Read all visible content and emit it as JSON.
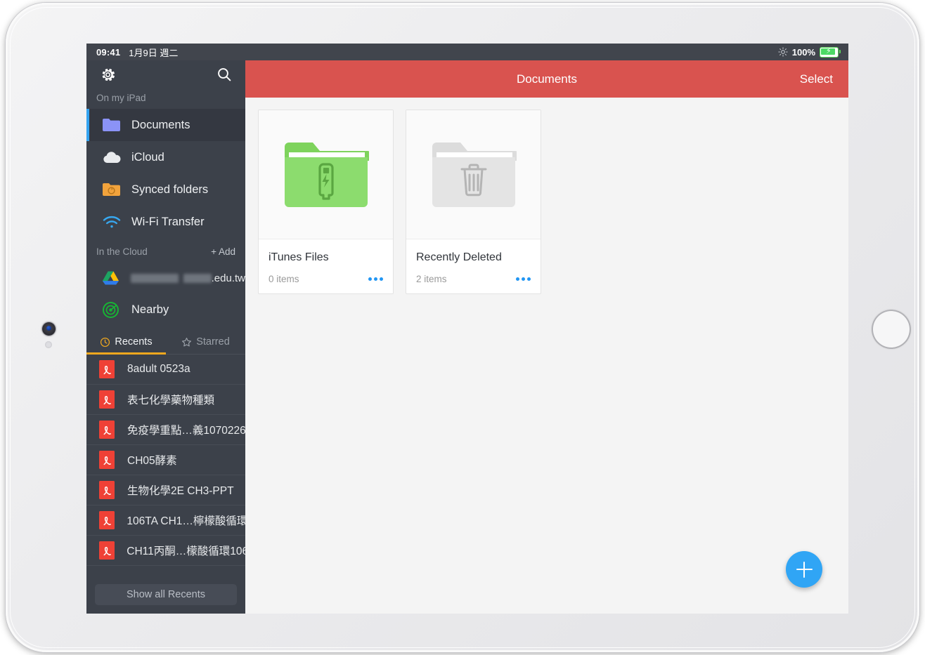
{
  "status_bar": {
    "time": "09:41",
    "date": "1月9日 週二",
    "brightness_icon": "sun-icon",
    "battery_percent": "100%",
    "battery_icon": "battery-charging-icon"
  },
  "sidebar": {
    "settings_icon": "gear-icon",
    "search_icon": "search-icon",
    "on_my_ipad_label": "On my iPad",
    "local_items": [
      {
        "label": "Documents",
        "icon": "folder-icon",
        "selected": true
      },
      {
        "label": "iCloud",
        "icon": "cloud-icon",
        "selected": false
      },
      {
        "label": "Synced folders",
        "icon": "synced-folder-icon",
        "selected": false
      },
      {
        "label": "Wi-Fi Transfer",
        "icon": "wifi-icon",
        "selected": false
      }
    ],
    "in_the_cloud_label": "In the Cloud",
    "add_label": "+ Add",
    "cloud_items": [
      {
        "label": ".edu.tw",
        "icon": "google-drive-icon",
        "redacted": true
      },
      {
        "label": "Nearby",
        "icon": "nearby-radar-icon",
        "redacted": false
      }
    ],
    "tabs": [
      {
        "label": "Recents",
        "icon": "clock-icon",
        "active": true
      },
      {
        "label": "Starred",
        "icon": "star-icon",
        "active": false
      }
    ],
    "recent_files": [
      {
        "name": "8adult 0523a",
        "icon": "pdf-icon"
      },
      {
        "name": "表七化學藥物種類",
        "icon": "pdf-icon"
      },
      {
        "name": "免疫學重點…義1070226",
        "icon": "pdf-icon"
      },
      {
        "name": "CH05酵素",
        "icon": "pdf-icon"
      },
      {
        "name": "生物化學2E CH3-PPT",
        "icon": "pdf-icon"
      },
      {
        "name": "106TA CH1…檸檬酸循環",
        "icon": "pdf-icon"
      },
      {
        "name": "CH11丙酮…檬酸循環106",
        "icon": "pdf-icon"
      }
    ],
    "show_all_label": "Show all Recents"
  },
  "main": {
    "title": "Documents",
    "select_label": "Select",
    "cards": [
      {
        "name": "iTunes Files",
        "count": "0 items",
        "thumb_icon": "green-folder-usb-icon",
        "more_icon": "more-dots-icon"
      },
      {
        "name": "Recently Deleted",
        "count": "2 items",
        "thumb_icon": "gray-folder-trash-icon",
        "more_icon": "more-dots-icon"
      }
    ],
    "fab_icon": "plus-icon"
  },
  "device": {
    "camera_icon": "front-camera",
    "home_button_icon": "home-button"
  },
  "colors": {
    "header_red": "#d9534f",
    "sidebar_dark": "#3c414a",
    "accent_blue": "#34a3f0",
    "tab_underline": "#f0a81e",
    "fab_blue": "#30a5f5",
    "folder_green": "#8cdc6e",
    "pdf_red": "#ef4136"
  }
}
